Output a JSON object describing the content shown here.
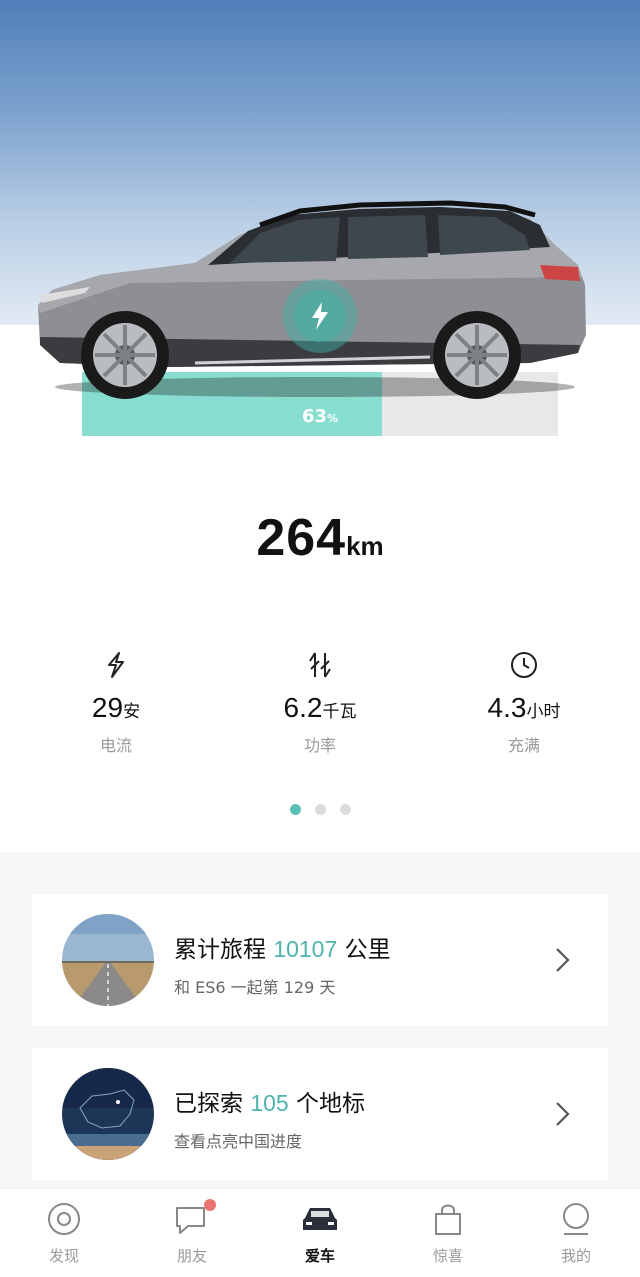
{
  "hero": {
    "battery_percent": 63,
    "battery_value": "63",
    "battery_unit": "%",
    "charging_icon": "lightning-bolt-icon"
  },
  "range": {
    "value": "264",
    "unit": "km"
  },
  "stats": [
    {
      "icon": "current-bolt-icon",
      "value": "29",
      "unit": "安",
      "label": "电流"
    },
    {
      "icon": "power-arrows-icon",
      "value": "6.2",
      "unit": "千瓦",
      "label": "功率"
    },
    {
      "icon": "clock-icon",
      "value": "4.3",
      "unit": "小时",
      "label": "充满"
    }
  ],
  "pager": {
    "count": 3,
    "active": 0
  },
  "cards": [
    {
      "title_prefix": "累计旅程 ",
      "highlight": "10107",
      "title_suffix": " 公里",
      "subtitle": "和 ES6 一起第 129 天",
      "thumb": "road-photo"
    },
    {
      "title_prefix": "已探索 ",
      "highlight": "105",
      "title_suffix": " 个地标",
      "subtitle": "查看点亮中国进度",
      "thumb": "china-map-photo"
    }
  ],
  "tabs": [
    {
      "label": "发现",
      "icon": "discover-circle-icon",
      "active": false
    },
    {
      "label": "朋友",
      "icon": "chat-bubble-icon",
      "active": false,
      "badge": true
    },
    {
      "label": "爱车",
      "icon": "car-icon",
      "active": true
    },
    {
      "label": "惊喜",
      "icon": "shopping-bag-icon",
      "active": false
    },
    {
      "label": "我的",
      "icon": "profile-icon",
      "active": false
    }
  ],
  "colors": {
    "accent": "#4fb3ad",
    "battery_fill": "#86ddd0",
    "badge": "#e8736f",
    "active_dot": "#5bbfb8"
  }
}
